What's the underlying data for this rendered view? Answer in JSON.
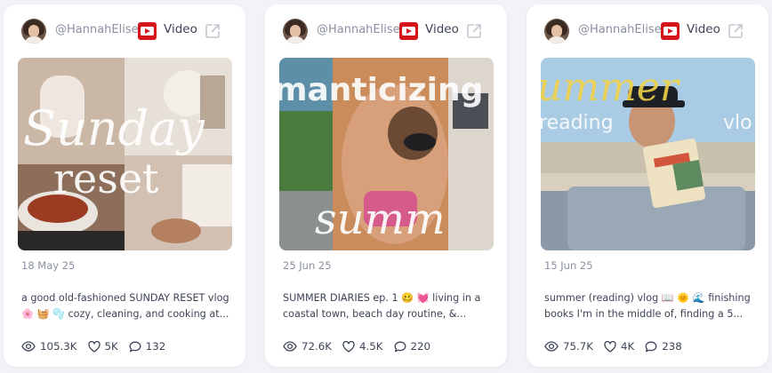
{
  "cards": [
    {
      "handle": "@HannahElise",
      "type_label": "Video",
      "date": "18 May 25",
      "description": "a good old-fashioned SUNDAY RESET vlog 🌸 🧺 🫧 cozy, cleaning, and cooking at...",
      "views": "105.3K",
      "likes": "5K",
      "comments": "132",
      "thumb_text_1": "Sunday",
      "thumb_text_2": "reset"
    },
    {
      "handle": "@HannahElise",
      "type_label": "Video",
      "date": "25 Jun 25",
      "description": "SUMMER DIARIES ep. 1 🥴 💓 living in a coastal town, beach day routine, &...",
      "views": "72.6K",
      "likes": "4.5K",
      "comments": "220",
      "thumb_text_1": "manticizing",
      "thumb_text_2": "summ"
    },
    {
      "handle": "@HannahElise",
      "type_label": "Video",
      "date": "15 Jun 25",
      "description": "summer (reading) vlog 📖 🌞 🌊 finishing books I'm in the middle of, finding a 5...",
      "views": "75.7K",
      "likes": "4K",
      "comments": "238",
      "thumb_text_1": "ummer",
      "thumb_text_2": "reading",
      "thumb_text_3": "vlo"
    }
  ],
  "colors": {
    "page_bg": "#f1f3f8",
    "card_bg": "#ffffff",
    "youtube_red": "#d4161a",
    "muted_text": "#8a90a0",
    "body_text": "#3d4456"
  },
  "icons": [
    "avatar",
    "youtube-icon",
    "external-link-icon",
    "eye-icon",
    "heart-icon",
    "comment-icon"
  ]
}
